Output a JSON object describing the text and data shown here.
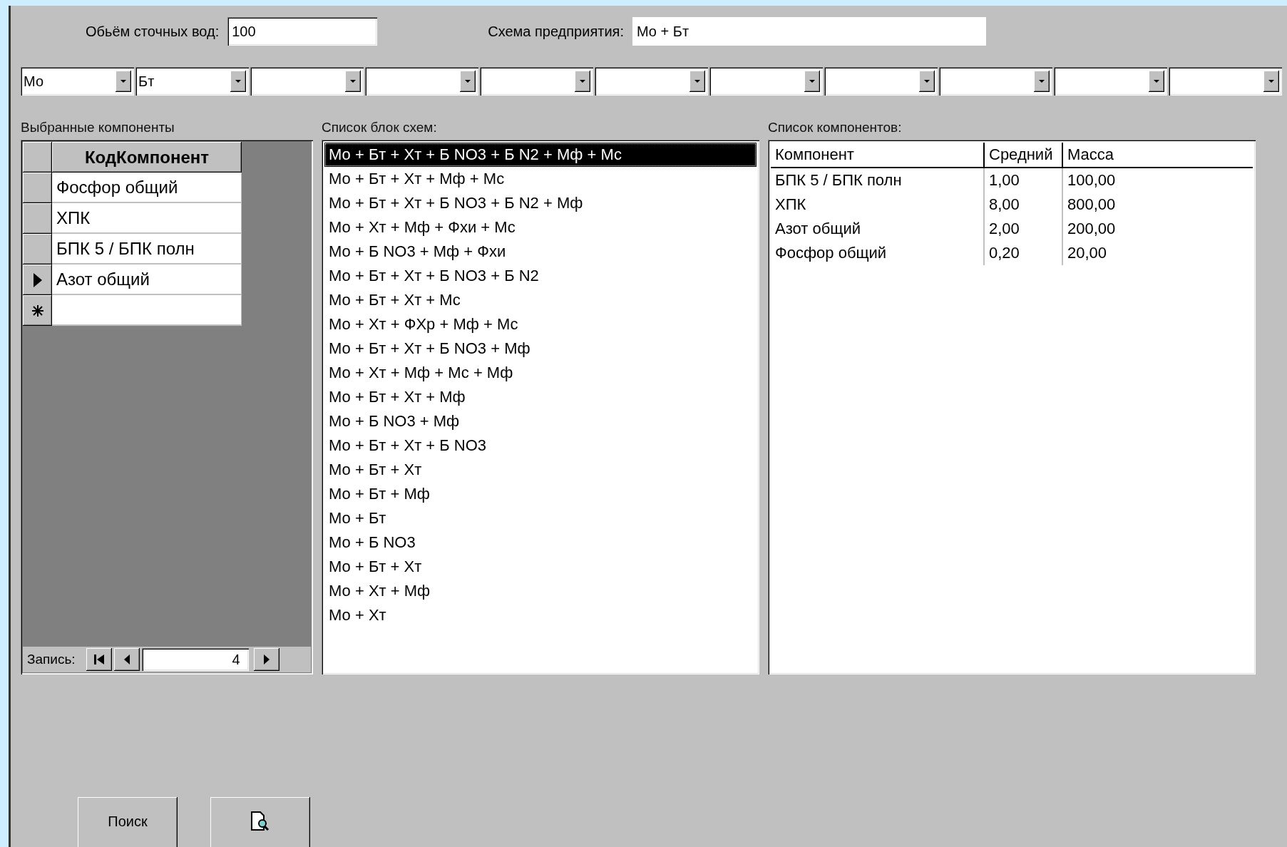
{
  "volume_field": {
    "label": "Обьём сточных вод:",
    "value": "100"
  },
  "scheme_field": {
    "label": "Схема предприятия:",
    "value": "Мо + Бт"
  },
  "combo_boxes": [
    {
      "kind": "filled",
      "value": "Мо"
    },
    {
      "kind": "filled",
      "value": "Бт"
    },
    {
      "kind": "empty"
    },
    {
      "kind": "empty"
    },
    {
      "kind": "empty"
    },
    {
      "kind": "empty"
    },
    {
      "kind": "empty"
    },
    {
      "kind": "empty"
    },
    {
      "kind": "empty"
    },
    {
      "kind": "empty"
    },
    {
      "kind": "empty"
    }
  ],
  "selected_components": {
    "label": "Выбранные компоненты",
    "column": "КодКомпонент",
    "rows": [
      {
        "text": "Фосфор общий",
        "current": false
      },
      {
        "text": "ХПК",
        "current": false
      },
      {
        "text": "БПК 5 / БПК полн",
        "current": false
      },
      {
        "text": "Азот общий",
        "current": true
      }
    ],
    "new_row": true,
    "navigation": {
      "label": "Запись:",
      "record": "4"
    }
  },
  "scheme_list": {
    "label": "Список блок схем:",
    "items": [
      {
        "text": "Мо + Бт + Хт + Б NO3 + Б N2 + Мф + Мс",
        "selected": true
      },
      {
        "text": "Мо + Бт + Хт + Мф + Мс",
        "selected": false
      },
      {
        "text": "Мо + Бт + Хт + Б NO3 + Б N2 + Мф",
        "selected": false
      },
      {
        "text": "Мо + Хт + Мф + Фхи + Мс",
        "selected": false
      },
      {
        "text": "Мо + Б NO3 + Мф + Фхи",
        "selected": false
      },
      {
        "text": "Мо + Бт + Хт + Б NO3 + Б N2",
        "selected": false
      },
      {
        "text": "Мо + Бт + Хт + Мс",
        "selected": false
      },
      {
        "text": "Мо + Хт + ФХр + Мф + Мс",
        "selected": false
      },
      {
        "text": "Мо + Бт + Хт + Б NO3 + Мф",
        "selected": false
      },
      {
        "text": "Мо + Хт + Мф + Мс + Мф",
        "selected": false
      },
      {
        "text": "Мо + Бт + Хт + Мф",
        "selected": false
      },
      {
        "text": "Мо + Б NO3 + Мф",
        "selected": false
      },
      {
        "text": "Мо + Бт + Хт + Б NO3",
        "selected": false
      },
      {
        "text": "Мо + Бт + Хт",
        "selected": false
      },
      {
        "text": "Мо + Бт + Мф",
        "selected": false
      },
      {
        "text": "Мо + Бт",
        "selected": false
      },
      {
        "text": "Мо + Б NO3",
        "selected": false
      },
      {
        "text": "Мо + Бт + Хт",
        "selected": false
      },
      {
        "text": "Мо + Хт + Мф",
        "selected": false
      },
      {
        "text": "Мо + Хт",
        "selected": false
      }
    ]
  },
  "component_list": {
    "label": "Список компонентов:",
    "columns": [
      "Компонент",
      "Средний",
      "Масса"
    ],
    "rows": [
      [
        "БПК 5 / БПК полн",
        "1,00",
        "100,00"
      ],
      [
        "ХПК",
        "8,00",
        "800,00"
      ],
      [
        "Азот общий",
        "2,00",
        "200,00"
      ],
      [
        "Фосфор общий",
        "0,20",
        "20,00"
      ]
    ]
  },
  "buttons": [
    {
      "kind": "text",
      "label": "Поиск"
    },
    {
      "kind": "preview"
    }
  ]
}
